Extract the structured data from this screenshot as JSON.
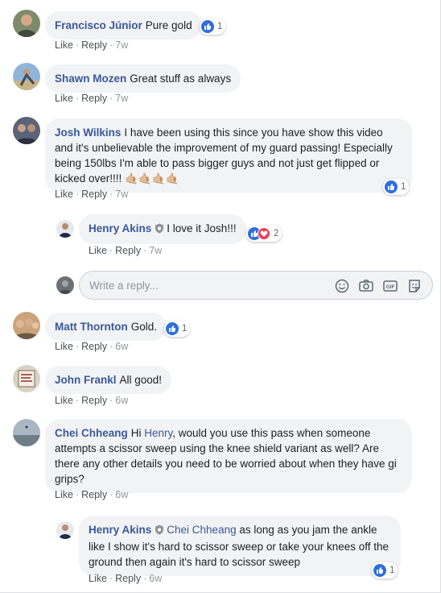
{
  "colors": {
    "author": "#385898",
    "bubble": "#f2f3f5",
    "like": "#2e6fe0",
    "love": "#f33e58"
  },
  "actions": {
    "like": "Like",
    "reply": "Reply",
    "dot": "·"
  },
  "comments": [
    {
      "author": "Francisco Júnior",
      "text": "Pure gold",
      "time": "7w",
      "reactions": "1",
      "avatar_icon": "person-avatar"
    },
    {
      "author": "Shawn Mozen",
      "text": "Great stuff as always",
      "time": "7w",
      "avatar_icon": "person-avatar"
    },
    {
      "author": "Josh Wilkins",
      "text": "I have been using this since you have show this video and it's unbelievable the improvement of my guard passing! Especially being 150lbs I'm able to pass bigger guys and not just get flipped or kicked over!!!! 🤙🏼🤙🏼🤙🏼🤙🏼",
      "time": "7w",
      "reactions": "1",
      "avatar_icon": "person-avatar"
    },
    {
      "author": "Henry Akins",
      "text": "I love it Josh!!!",
      "time": "7w",
      "reactions": "2",
      "avatar_icon": "person-avatar",
      "badge_icon": "shield-badge-icon"
    },
    {
      "author": "Matt Thornton",
      "text": "Gold.",
      "time": "6w",
      "reactions": "1",
      "avatar_icon": "person-avatar"
    },
    {
      "author": "John Frankl",
      "text": "All good!",
      "time": "6w",
      "avatar_icon": "sign-avatar"
    },
    {
      "author": "Chei Chheang",
      "text_pre": "Hi ",
      "mention": "Henry",
      "text": ", would you use this pass when someone attempts a scissor sweep using the knee shield variant as well? Are there any other details you need to be worried about when they have gi grips?",
      "time": "6w",
      "avatar_icon": "landscape-avatar"
    },
    {
      "author": "Henry Akins",
      "mention": "Chei Chheang",
      "text": " as long as you jam the ankle like I show it's hard to scissor sweep or take your knees off the ground then again it's hard to scissor sweep",
      "time": "6w",
      "reactions": "1",
      "avatar_icon": "person-avatar",
      "badge_icon": "shield-badge-icon"
    }
  ],
  "reply_box": {
    "placeholder": "Write a reply...",
    "icons": [
      "emoji-icon",
      "camera-icon",
      "gif-icon",
      "sticker-icon"
    ],
    "gif_label": "GIF"
  }
}
